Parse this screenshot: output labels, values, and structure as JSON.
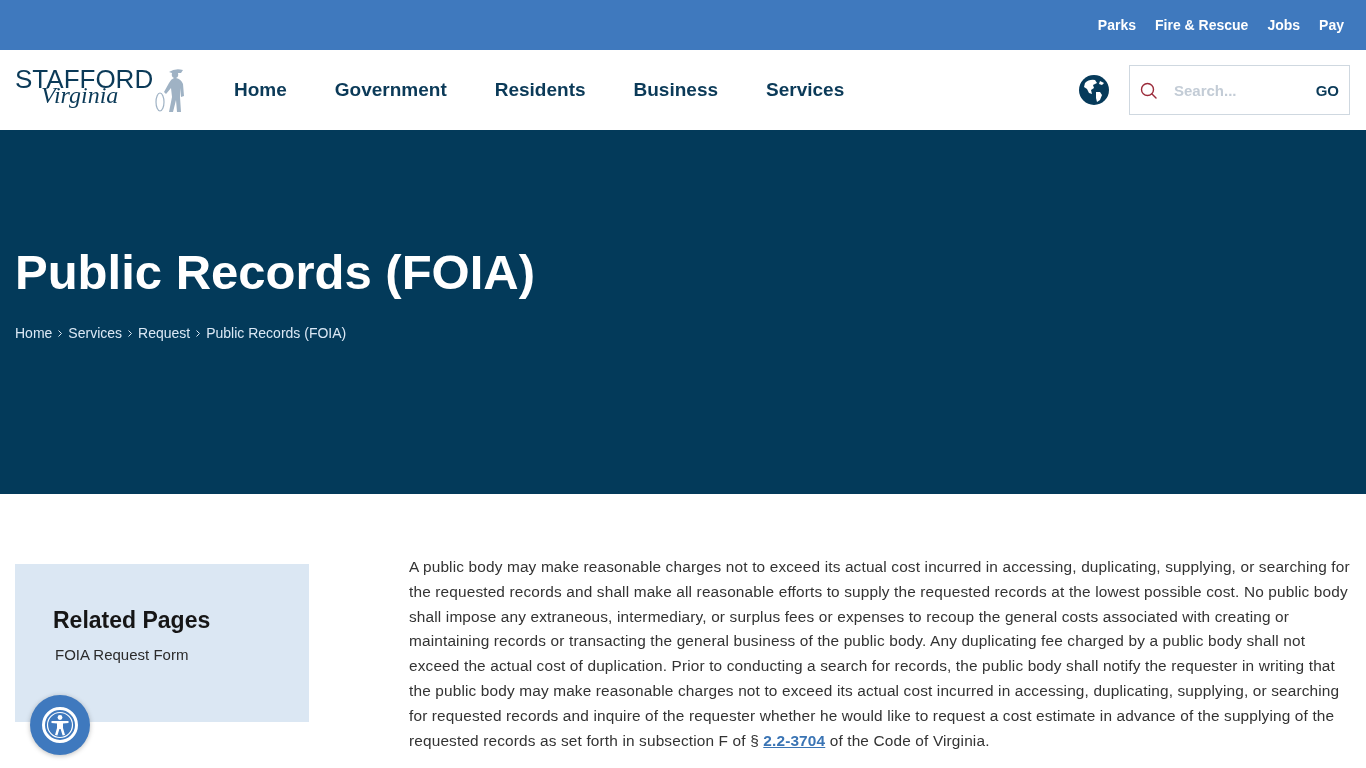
{
  "utility_bar": {
    "links": [
      "Parks",
      "Fire & Rescue",
      "Jobs",
      "Pay"
    ]
  },
  "header": {
    "logo": {
      "wordmark": "STAFFORD",
      "script": "Virginia"
    },
    "nav": [
      "Home",
      "Government",
      "Residents",
      "Business",
      "Services"
    ],
    "search": {
      "placeholder": "Search...",
      "button": "GO"
    }
  },
  "hero": {
    "title": "Public Records (FOIA)",
    "breadcrumb": [
      "Home",
      "Services",
      "Request",
      "Public Records (FOIA)"
    ]
  },
  "sidebar": {
    "title": "Related Pages",
    "links": [
      "FOIA Request Form"
    ]
  },
  "article": {
    "text_before": "A public body may make reasonable charges not to exceed its actual cost incurred in accessing, duplicating, supplying, or searching for the requested records and shall make all reasonable efforts to supply the requested records at the lowest possible cost. No public body shall impose any extraneous, intermediary, or surplus fees or expenses to recoup the general costs associated with creating or maintaining records or transacting the general business of the public body. Any duplicating fee charged by a public body shall not exceed the actual cost of duplication. Prior to conducting a search for records, the public body shall notify the requester in writing that the public body may make reasonable charges not to exceed its actual cost incurred in accessing, duplicating, supplying, or searching for requested records and inquire of the requester whether he would like to request a cost estimate in advance of the supplying of the requested records as set forth in subsection F of § ",
    "link": "2.2-3704",
    "text_after": " of the Code of Virginia."
  }
}
